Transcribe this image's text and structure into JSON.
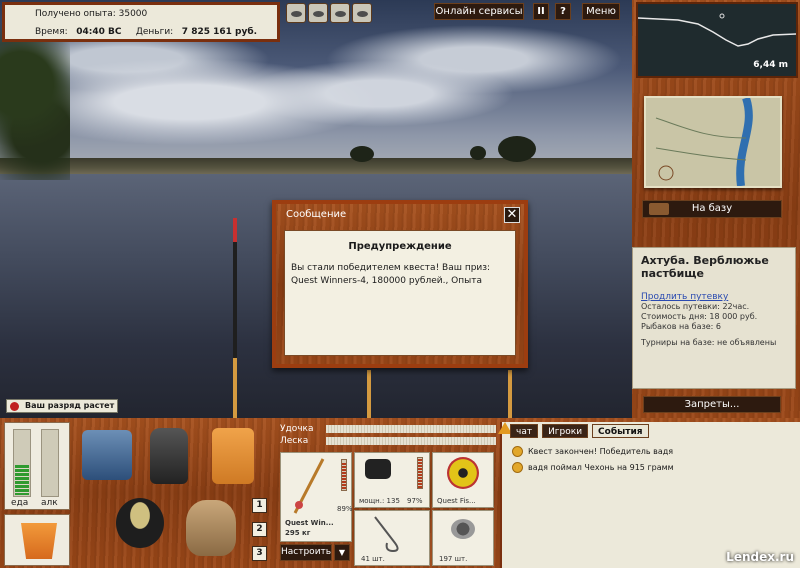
{
  "status": {
    "experience_label": "Получено опыта:",
    "experience_value": "35000",
    "time_label": "Время:",
    "time_value": "04:40 ВС",
    "money_label": "Деньги:",
    "money_value": "7 825 161 руб."
  },
  "toolbar": {
    "online_services": "Онлайн сервисы",
    "pause": "II",
    "help": "?",
    "menu": "Меню"
  },
  "depth": {
    "value": "6,44 m"
  },
  "base_button": "На базу",
  "location": {
    "title": "Ахтуба. Верблюжье пастбище",
    "extend_link": "Продлить путевку",
    "lines": [
      "Осталось путевки: 22час.",
      "Стоимость дня: 18 000 руб.",
      "Рыбаков на базе: 6",
      "Турниры на базе: не объявлены"
    ]
  },
  "bans_button": "Запреты...",
  "rank_toast": "Ваш разряд растет",
  "dialog": {
    "header": "Сообщение",
    "close": "✕",
    "title": "Предупреждение",
    "text": "Вы стали победителем квеста! Ваш приз: Quest Winners-4, 180000 рублей., Опыта"
  },
  "meters": {
    "food_label": "еда",
    "alc_label": "алк",
    "food_level": 0.45,
    "alc_level": 0.0
  },
  "slots": [
    "1",
    "2",
    "3"
  ],
  "rod_panel": {
    "rod_label": "Удочка",
    "line_label": "Леска",
    "rod_name": "Quest Win...",
    "rod_weight": "295 кг",
    "rod_pct": "89%",
    "reel_power": "мощн.: 135",
    "reel_pct": "97%",
    "line_name": "Quest Fis...",
    "hooks_count": "41 шт.",
    "bait_count": "197 шт.",
    "setup_button": "Настроить",
    "setup_dropdown": "▼"
  },
  "chat": {
    "tabs": [
      "чат",
      "Игроки",
      "События"
    ],
    "active_tab": "События",
    "events": [
      "Квест закончен! Победитель вадя",
      "вадя поймал Чехонь на 915 грамм"
    ]
  },
  "watermark": "Lendex.ru"
}
